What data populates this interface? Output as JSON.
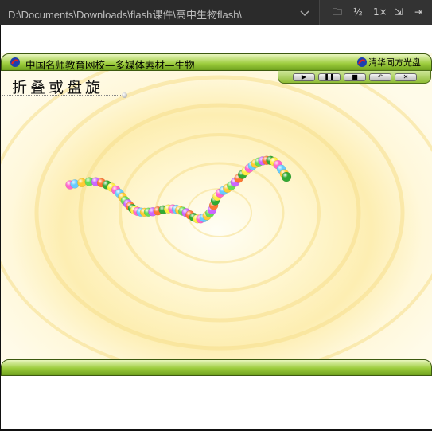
{
  "window": {
    "path": "D:\\Documents\\Downloads\\flash课件\\高中生物flash\\",
    "buttons": {
      "folder": "🗀",
      "half": "½",
      "one_x": "1×",
      "fit": "⇲",
      "pin": "⇥"
    }
  },
  "flash": {
    "header_title": "中国名师教育网校—多媒体素材—生物",
    "publisher": "清华同方光盘",
    "heading": "折叠或盘旋",
    "controls": {
      "play": "▶",
      "pause": "❚❚",
      "stop": "■",
      "rewind": "↶",
      "close": "✕"
    }
  },
  "colors": {
    "titlebar": "#2b2b2b",
    "bar_green": "#9ccc3c",
    "background": "#fff9e0",
    "beads": [
      "#ff66cc",
      "#66ccff",
      "#ffcc33",
      "#66dd55",
      "#cc66ff",
      "#ff7733",
      "#33aa33",
      "#ffee44"
    ]
  }
}
